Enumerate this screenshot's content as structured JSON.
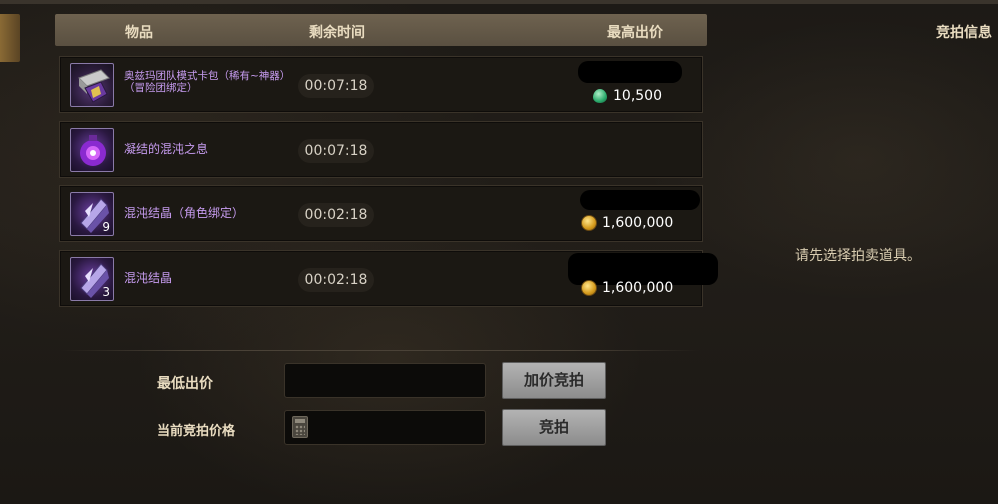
{
  "list_header": {
    "item": "物品",
    "time_left": "剩余时间",
    "highest_bid": "最高出价"
  },
  "side_panel": {
    "title": "竞拍信息",
    "empty_message": "请先选择拍卖道具。"
  },
  "items": [
    {
      "name_line1": "奥兹玛团队模式卡包（稀有~神器）",
      "name_line2": "（冒险团绑定）",
      "time_left": "00:07:18",
      "stack": "",
      "bid": "10,500",
      "currency": "gem-icon"
    },
    {
      "name_line1": "凝结的混沌之息",
      "name_line2": "",
      "time_left": "00:07:18",
      "stack": "",
      "bid": "",
      "currency": ""
    },
    {
      "name_line1": "混沌结晶（角色绑定）",
      "name_line2": "",
      "time_left": "00:02:18",
      "stack": "9",
      "bid": "1,600,000",
      "currency": "coin-icon"
    },
    {
      "name_line1": "混沌结晶",
      "name_line2": "",
      "time_left": "00:02:18",
      "stack": "3",
      "bid": "1,600,000",
      "currency": "coin-icon"
    }
  ],
  "form": {
    "min_bid_label": "最低出价",
    "min_bid_value": "",
    "current_bid_label": "当前竞拍价格",
    "current_bid_value": "",
    "raise_button": "加价竞拍",
    "bid_button": "竞拍"
  },
  "colors": {
    "item_name": "#c79cf0",
    "header_bg": "#6e624f",
    "button_bg": "#a0a0a0"
  }
}
